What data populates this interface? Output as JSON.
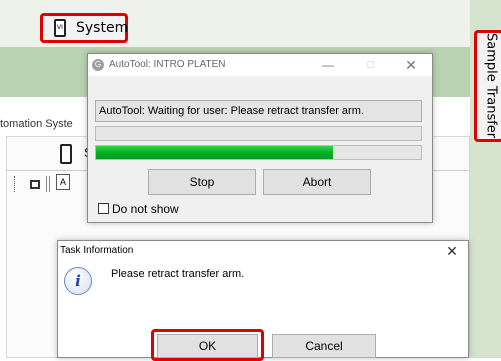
{
  "app": {
    "system_button_label": "System",
    "sample_transfer_label": "Sample Transfer",
    "menu_text": "tomation   Syste",
    "panel_letter": "S"
  },
  "autotool": {
    "title": "AutoTool: INTRO PLATEN",
    "status_message": "AutoTool: Waiting for user: Please retract transfer arm.",
    "progress_percent": 73,
    "stop_label": "Stop",
    "abort_label": "Abort",
    "do_not_show_label": "Do not show",
    "do_not_show_checked": false
  },
  "task_info": {
    "title": "Task Information",
    "message": "Please retract transfer arm.",
    "ok_label": "OK",
    "cancel_label": "Cancel"
  },
  "colors": {
    "highlight_red": "#e00000",
    "progress_green": "#06b025",
    "app_green": "#b9d3b2"
  },
  "icons": [
    "vi-icon",
    "autotool-icon",
    "minimize-icon",
    "maximize-icon",
    "close-icon",
    "information-icon"
  ]
}
